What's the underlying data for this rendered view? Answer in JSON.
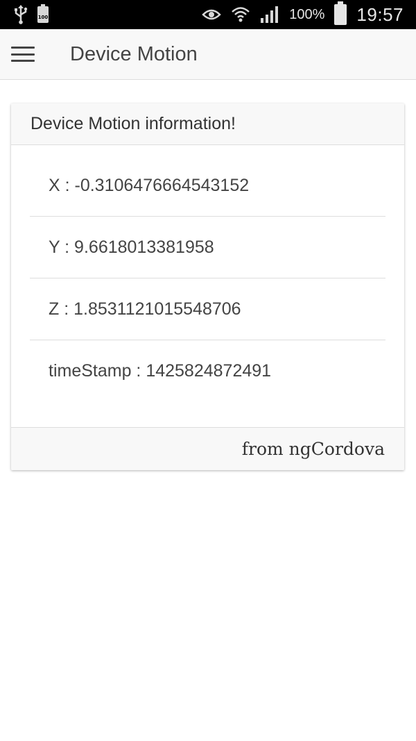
{
  "status_bar": {
    "icons": [
      "usb-icon",
      "battery-small-icon",
      "eye-icon",
      "wifi-icon",
      "signal-icon",
      "battery-icon"
    ],
    "small_battery_label": "100",
    "battery_percent": "100%",
    "time": "19:57"
  },
  "header": {
    "menu_icon": "hamburger-menu-icon",
    "title": "Device Motion"
  },
  "card": {
    "title": "Device Motion information!",
    "items": [
      {
        "label": "X",
        "value": "-0.3106476664543152",
        "text": "X : -0.3106476664543152"
      },
      {
        "label": "Y",
        "value": "9.6618013381958",
        "text": "Y : 9.6618013381958"
      },
      {
        "label": "Z",
        "value": "1.8531121015548706",
        "text": "Z : 1.8531121015548706"
      },
      {
        "label": "timeStamp",
        "value": "1425824872491",
        "text": "timeStamp : 1425824872491"
      }
    ],
    "footer": "from ngCordova"
  }
}
